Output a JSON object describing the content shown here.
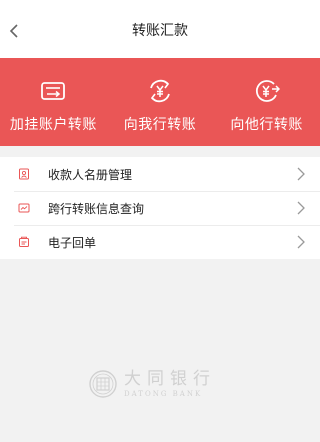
{
  "header": {
    "title": "转账汇款",
    "back_icon": "chevron-left-icon"
  },
  "banner": {
    "background_color": "#ea5656",
    "items": [
      {
        "label": "加挂账户转账",
        "icon": "linked-card-icon"
      },
      {
        "label": "向我行转账",
        "icon": "yuan-exchange-icon"
      },
      {
        "label": "向他行转账",
        "icon": "yuan-transfer-out-icon"
      }
    ]
  },
  "menu": {
    "accent_color": "#ea5656",
    "items": [
      {
        "label": "收款人名册管理",
        "icon": "payee-book-icon"
      },
      {
        "label": "跨行转账信息查询",
        "icon": "interbank-query-icon"
      },
      {
        "label": "电子回单",
        "icon": "e-receipt-icon"
      }
    ]
  },
  "footer": {
    "brand_cn": "大同银行",
    "brand_en": "DATONG BANK"
  }
}
